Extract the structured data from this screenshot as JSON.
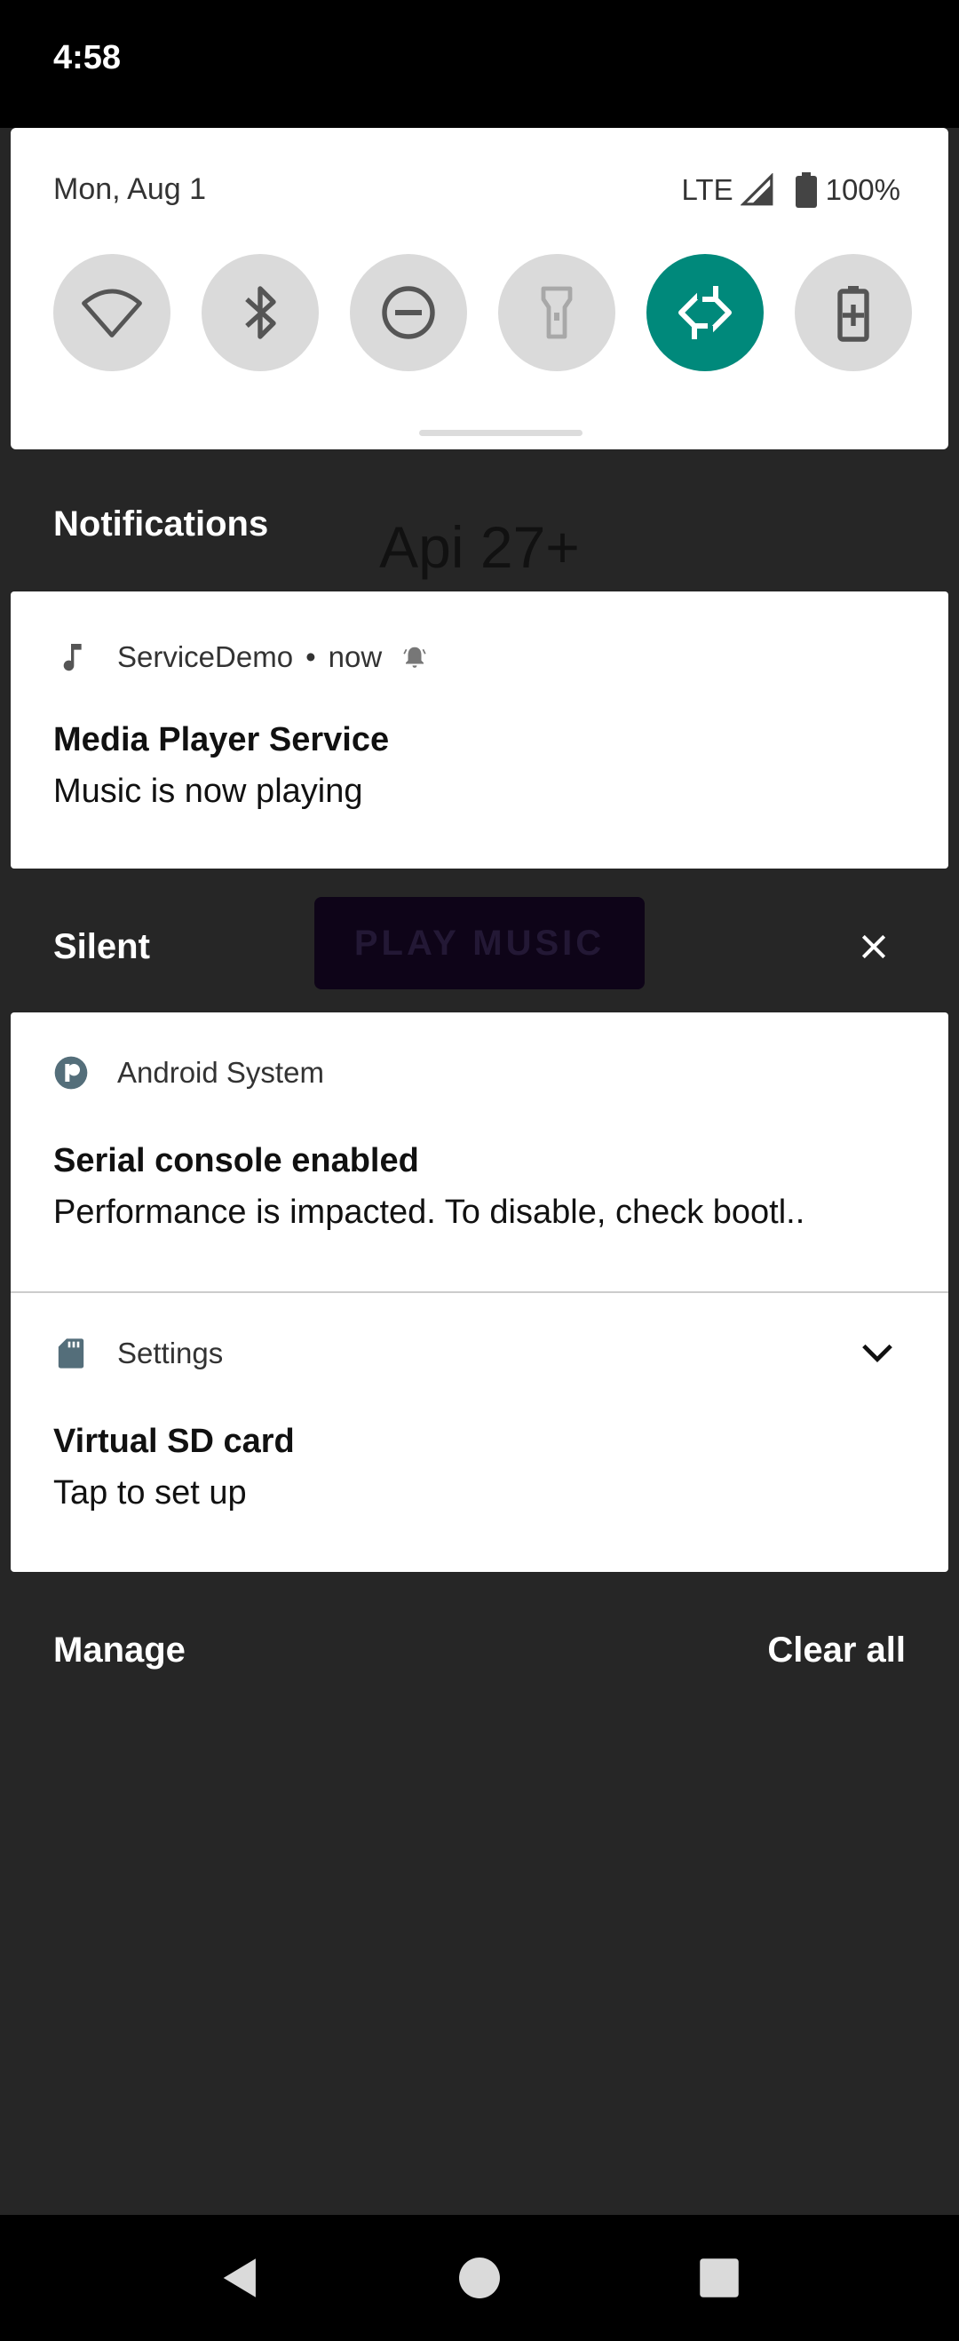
{
  "status_bar": {
    "time": "4:58"
  },
  "quick_settings": {
    "date": "Mon, Aug 1",
    "network": "LTE",
    "battery": "100%",
    "tiles": [
      {
        "icon": "wifi-icon",
        "active": false
      },
      {
        "icon": "bluetooth-icon",
        "active": false
      },
      {
        "icon": "do-not-disturb-icon",
        "active": false
      },
      {
        "icon": "flashlight-icon",
        "active": false
      },
      {
        "icon": "auto-rotate-icon",
        "active": true
      },
      {
        "icon": "battery-saver-icon",
        "active": false
      }
    ],
    "accent_color": "#00897b"
  },
  "background_app": {
    "title": "Api 27+",
    "button_label": "PLAY MUSIC"
  },
  "notifications_header": "Notifications",
  "media_notification": {
    "app_name": "ServiceDemo",
    "separator": "•",
    "time": "now",
    "title": "Media Player Service",
    "text": "Music is now playing",
    "app_icon": "music-note-icon"
  },
  "silent_header": "Silent",
  "silent_notifications": [
    {
      "app_name": "Android System",
      "title": "Serial console enabled",
      "text": "Performance is impacted. To disable, check bootl..",
      "app_icon": "android-system-icon"
    },
    {
      "app_name": "Settings",
      "title": "Virtual SD card",
      "text": "Tap to set up",
      "app_icon": "sd-card-icon"
    }
  ],
  "footer": {
    "manage": "Manage",
    "clear_all": "Clear all"
  },
  "colors": {
    "shade_background": "#262626",
    "card_background": "#ffffff",
    "system_bars": "#000000"
  }
}
